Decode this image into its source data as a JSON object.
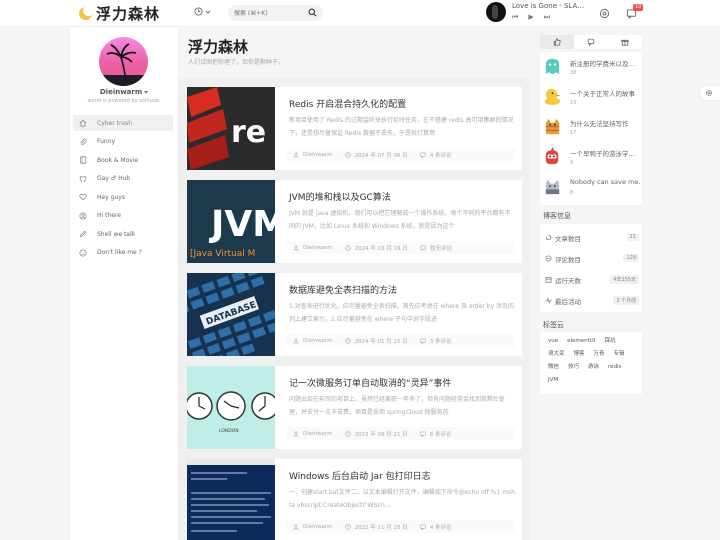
{
  "site": {
    "logo_text": "浮力森林",
    "search_placeholder": "搜索 (⌘+K)"
  },
  "player": {
    "title": "Love is Gone - SLA…",
    "controls": [
      "⏮",
      "▶",
      "⏭"
    ]
  },
  "header_icons": [
    "clock-icon",
    "search-icon",
    "gear-icon",
    "bell-icon"
  ],
  "notification_count": "10",
  "profile": {
    "name": "Dieinwarm",
    "tagline": "world is powered by solitude."
  },
  "nav": [
    {
      "label": "Cyber trash",
      "icon": "home-icon",
      "active": true
    },
    {
      "label": "Funny",
      "icon": "paperclip-icon",
      "active": false
    },
    {
      "label": "Book & Movie",
      "icon": "book-icon",
      "active": false
    },
    {
      "label": "Gay ♂ Hub",
      "icon": "github-icon",
      "active": false
    },
    {
      "label": "Hey guys",
      "icon": "heart-icon",
      "active": false
    },
    {
      "label": "Hi there",
      "icon": "user-icon",
      "active": false
    },
    {
      "label": "Shell we talk",
      "icon": "pen-icon",
      "active": false
    },
    {
      "label": "Don't like me ?",
      "icon": "sad-icon",
      "active": false
    }
  ],
  "page": {
    "title": "浮力森林",
    "subtitle": "人们试图把你埋了，但你是颗种子。"
  },
  "posts": [
    {
      "title": "Redis 开启混合持久化的配置",
      "summary": "新项目使用了 Redis 的过期监听来执行延时任务，在不搭建 redis 高可用集群的情况下，还是想尽量保证 Redis 数据不丢失，于是就打算用",
      "author": "Dieinwarm",
      "date": "2024 年 07 月 06 日",
      "comments": "4 条评论",
      "thumb": "redis-thumbnail"
    },
    {
      "title": "JVM的堆和栈以及GC算法",
      "summary": "JVM 就是 java 虚拟机，我们可以把它理解成一个操作系统，每个不同的平台都有不同的 JVM，比如 Linux 系统和 Windows 系统，就是因为这个",
      "author": "Dieinwarm",
      "date": "2024 年 03 月 19 日",
      "comments": "暂无评论",
      "thumb": "jvm-thumbnail"
    },
    {
      "title": "数据库避免全表扫描的方法",
      "summary": "1.对查询进行优化，应尽量避免全表扫描，首先应考虑在 where 及 order by 涉及的列上建立索引。2.应尽量避免在 where 子句中对字段进",
      "author": "Dieinwarm",
      "date": "2024 年 01 月 15 日",
      "comments": "3 条评论",
      "thumb": "database-thumbnail"
    },
    {
      "title": "记一次微服务订单自动取消的“灵异”事件",
      "summary": "问题出现在前司的项目上，虽然已经离职一年多了，但有问题经常会找到我帮忙处理，并支付一点辛苦费。项目是采用 springCloud 微服务的",
      "author": "Dieinwarm",
      "date": "2023 年 09 月 21 日",
      "comments": "6 条评论",
      "thumb": "clocks-thumbnail"
    },
    {
      "title": "Windows 后台启动 Jar 包打印日志",
      "summary": "一、创建start.bat文件二、以文本编辑打开文件，编辑如下命令@echo off %1 mshta vbscript:CreateObject(\"WScri…",
      "author": "Dieinwarm",
      "date": "2022 年 11 月 28 日",
      "comments": "4 条评论",
      "thumb": "console-thumbnail"
    }
  ],
  "right_tabs": [
    "thumbs-up-icon",
    "comment-icon",
    "gift-icon"
  ],
  "hot_list": [
    {
      "title": "新注册的学费米以及…",
      "count": "38",
      "icon": "ghost-teal-icon"
    },
    {
      "title": "一个关于正常人的故事",
      "count": "19",
      "icon": "duck-yellow-icon"
    },
    {
      "title": "为什么无法坚持写作",
      "count": "17",
      "icon": "cat-orange-icon"
    },
    {
      "title": "一个早鸭子的游泳学…",
      "count": "9",
      "icon": "bird-red-icon"
    },
    {
      "title": "Nobody can save me.",
      "count": "8",
      "icon": "cat-gray-icon"
    }
  ],
  "blog_info": {
    "title": "博客信息",
    "rows": [
      {
        "label": "文章数目",
        "value": "21",
        "icon": "article-icon"
      },
      {
        "label": "评论数目",
        "value": "129",
        "icon": "comments-icon"
      },
      {
        "label": "运行天数",
        "value": "4年155天",
        "icon": "calendar-icon"
      },
      {
        "label": "最后活动",
        "value": "3 个月前",
        "icon": "activity-icon"
      }
    ]
  },
  "tag_cloud": {
    "title": "标签云",
    "tags": [
      "vue",
      "elementUI",
      "踩坑",
      "浪大变",
      "博客",
      "万青",
      "专辑",
      "微信",
      "技巧",
      "游泳",
      "redis",
      "JVM"
    ]
  },
  "colors": {
    "accent": "#ee4f4f",
    "bg": "#f5f5f5"
  }
}
